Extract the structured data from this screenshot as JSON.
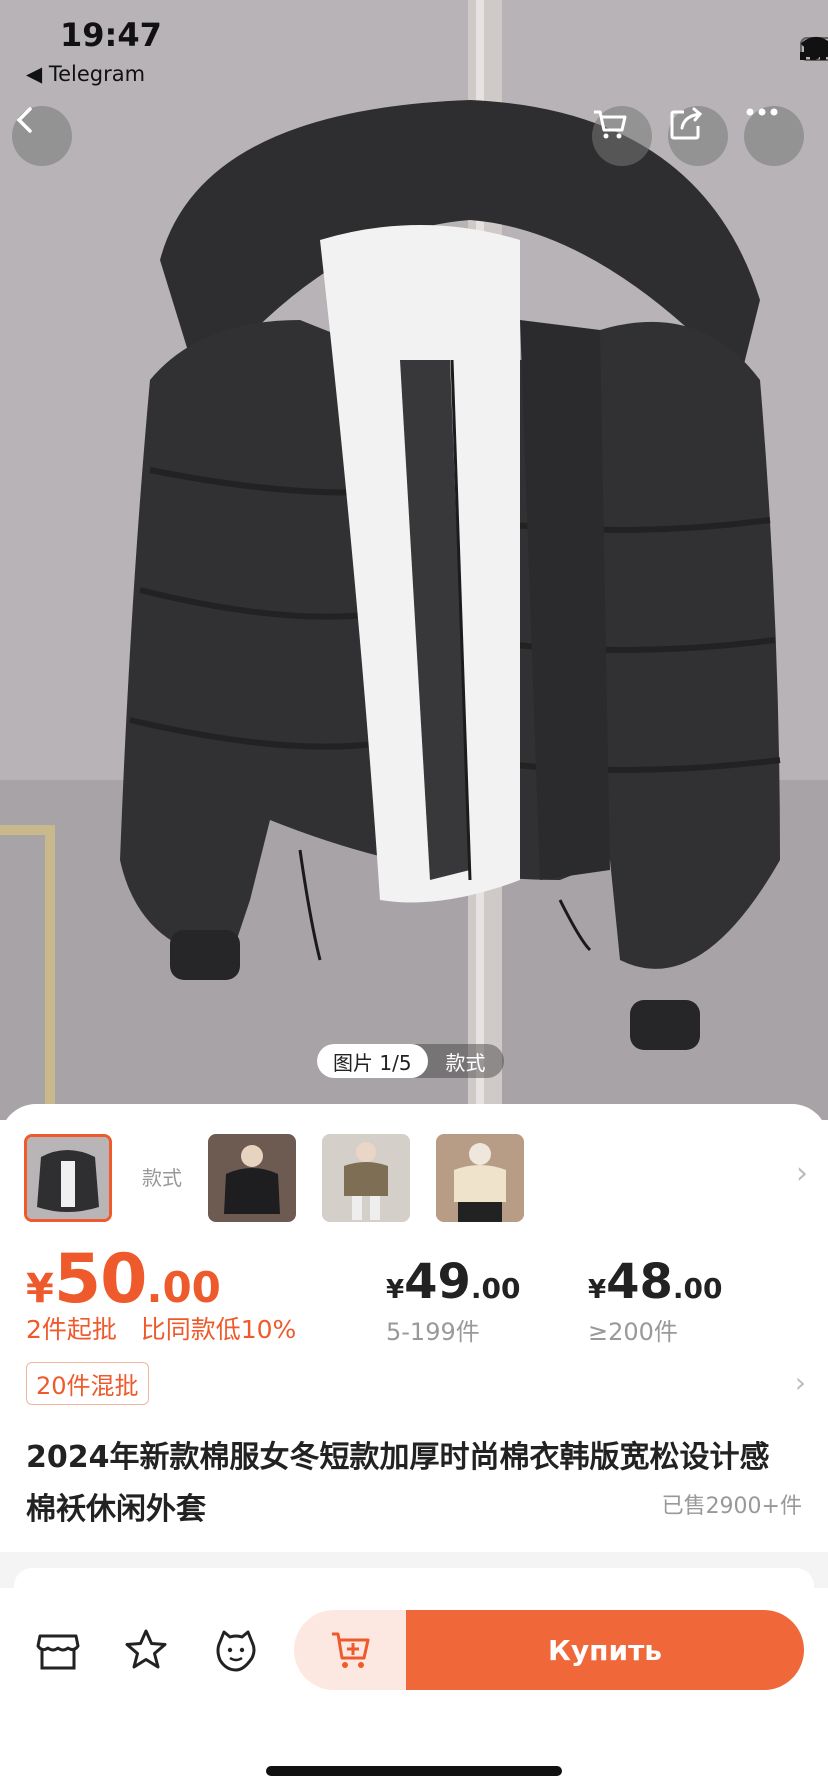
{
  "status_bar": {
    "time": "19:47",
    "back_app": "◀ Telegram"
  },
  "nav": {
    "back_icon": "chevron-left-icon",
    "cart_icon": "cart-icon",
    "share_icon": "share-icon",
    "more_icon": "more-dots-icon"
  },
  "gallery": {
    "pager_active": "图片 1/5",
    "pager_style": "款式"
  },
  "thumbnails": {
    "style_label": "款式",
    "count_selected": 1
  },
  "price": {
    "symbol": "¥",
    "main_int": "50",
    "main_dec": ".00",
    "moq_text": "2件起批   比同款低10%",
    "tiers": [
      {
        "symbol": "¥",
        "int": "49",
        "dec": ".00",
        "qty": "5-199件"
      },
      {
        "symbol": "¥",
        "int": "48",
        "dec": ".00",
        "qty": "≥200件"
      }
    ]
  },
  "mix_badge": "20件混批",
  "product": {
    "title": "2024年新款棉服女冬短款加厚时尚棉衣韩版宽松设计感棉袄休闲外套",
    "sold": "已售2900+件"
  },
  "actions": {
    "shop_icon": "shop-icon",
    "favorite_icon": "star-icon",
    "service_icon": "chat-face-icon",
    "add_cart_icon": "cart-plus-icon",
    "buy_label": "Купить"
  },
  "colors": {
    "accent": "#ee5a2b",
    "buy_button": "#f0673a",
    "cart_button_bg": "#fde8e1"
  }
}
